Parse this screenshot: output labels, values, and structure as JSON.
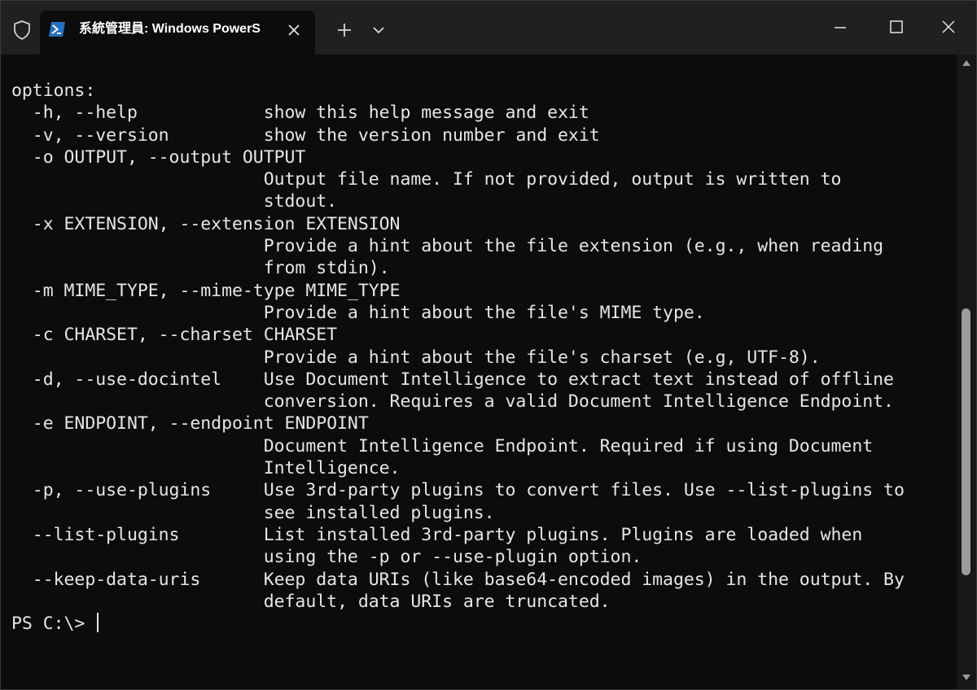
{
  "window": {
    "tab_title": "系統管理員: Windows PowerS",
    "controls": {
      "minimize": "minimize",
      "maximize": "maximize",
      "close": "close"
    },
    "icons": {
      "admin": "shield-icon",
      "tab": "powershell-icon",
      "tab_close": "close-icon",
      "new_tab": "plus-icon",
      "dropdown": "chevron-down-icon"
    }
  },
  "terminal": {
    "lines": [
      "options:",
      "  -h, --help            show this help message and exit",
      "  -v, --version         show the version number and exit",
      "  -o OUTPUT, --output OUTPUT",
      "                        Output file name. If not provided, output is written to",
      "                        stdout.",
      "  -x EXTENSION, --extension EXTENSION",
      "                        Provide a hint about the file extension (e.g., when reading",
      "                        from stdin).",
      "  -m MIME_TYPE, --mime-type MIME_TYPE",
      "                        Provide a hint about the file's MIME type.",
      "  -c CHARSET, --charset CHARSET",
      "                        Provide a hint about the file's charset (e.g, UTF-8).",
      "  -d, --use-docintel    Use Document Intelligence to extract text instead of offline",
      "                        conversion. Requires a valid Document Intelligence Endpoint.",
      "  -e ENDPOINT, --endpoint ENDPOINT",
      "                        Document Intelligence Endpoint. Required if using Document",
      "                        Intelligence.",
      "  -p, --use-plugins     Use 3rd-party plugins to convert files. Use --list-plugins to",
      "                        see installed plugins.",
      "  --list-plugins        List installed 3rd-party plugins. Plugins are loaded when",
      "                        using the -p or --use-plugin option.",
      "  --keep-data-uris      Keep data URIs (like base64-encoded images) in the output. By",
      "                        default, data URIs are truncated."
    ],
    "prompt": "PS C:\\> "
  },
  "colors": {
    "background": "#0c0c0c",
    "titlebar": "#202020",
    "text": "#e6e6e6",
    "powershell_blue": "#2671be"
  }
}
